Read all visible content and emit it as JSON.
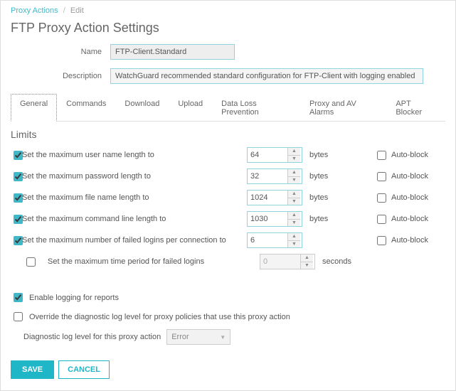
{
  "breadcrumb": {
    "link": "Proxy Actions",
    "current": "Edit"
  },
  "title": "FTP Proxy Action Settings",
  "form": {
    "name_label": "Name",
    "name_value": "FTP-Client.Standard",
    "desc_label": "Description",
    "desc_value": "WatchGuard recommended standard configuration for FTP-Client with logging enabled"
  },
  "tabs": [
    "General",
    "Commands",
    "Download",
    "Upload",
    "Data Loss Prevention",
    "Proxy and AV Alarms",
    "APT Blocker"
  ],
  "active_tab": 0,
  "limits_title": "Limits",
  "limits": [
    {
      "checked": true,
      "label": "Set the maximum user name length to",
      "value": "64",
      "unit": "bytes",
      "autoblock": false,
      "has_autoblock": true,
      "indent": false,
      "enabled": true
    },
    {
      "checked": true,
      "label": "Set the maximum password length to",
      "value": "32",
      "unit": "bytes",
      "autoblock": false,
      "has_autoblock": true,
      "indent": false,
      "enabled": true
    },
    {
      "checked": true,
      "label": "Set the maximum file name length to",
      "value": "1024",
      "unit": "bytes",
      "autoblock": false,
      "has_autoblock": true,
      "indent": false,
      "enabled": true
    },
    {
      "checked": true,
      "label": "Set the maximum command line length to",
      "value": "1030",
      "unit": "bytes",
      "autoblock": false,
      "has_autoblock": true,
      "indent": false,
      "enabled": true
    },
    {
      "checked": true,
      "label": "Set the maximum number of failed logins per connection to",
      "value": "6",
      "unit": "",
      "autoblock": false,
      "has_autoblock": true,
      "indent": false,
      "enabled": true
    },
    {
      "checked": false,
      "label": "Set the maximum time period for failed logins",
      "value": "0",
      "unit": "seconds",
      "autoblock": false,
      "has_autoblock": false,
      "indent": true,
      "enabled": false
    }
  ],
  "autoblock_label": "Auto-block",
  "logging": {
    "enable_checked": true,
    "enable_label": "Enable logging for reports",
    "override_checked": false,
    "override_label": "Override the diagnostic log level for proxy policies that use this proxy action",
    "level_label": "Diagnostic log level for this proxy action",
    "level_value": "Error"
  },
  "buttons": {
    "save": "SAVE",
    "cancel": "CANCEL"
  }
}
